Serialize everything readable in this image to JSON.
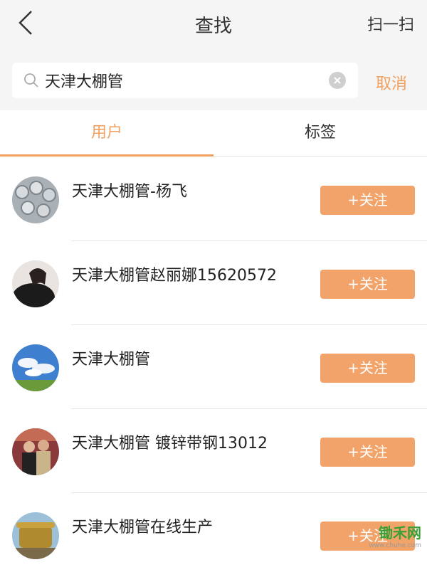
{
  "header": {
    "title": "查找",
    "scan_label": "扫一扫"
  },
  "search": {
    "value": "天津大棚管",
    "cancel_label": "取消"
  },
  "tabs": [
    {
      "label": "用户",
      "active": true
    },
    {
      "label": "标签",
      "active": false
    }
  ],
  "results": [
    {
      "name": "天津大棚管-杨飞",
      "follow_label": "+关注",
      "avatar": "pipes-photo"
    },
    {
      "name": "天津大棚管赵丽娜15620572",
      "follow_label": "+关注",
      "avatar": "woman-portrait"
    },
    {
      "name": "天津大棚管",
      "follow_label": "+关注",
      "avatar": "sky-clouds"
    },
    {
      "name": "天津大棚管 镀锌带钢13012",
      "follow_label": "+关注",
      "avatar": "couple-photo"
    },
    {
      "name": "天津大棚管在线生产",
      "follow_label": "+关注",
      "avatar": "brass-vessel"
    }
  ],
  "watermark": {
    "text": "锄禾网",
    "sub": "www.chuhe.com"
  },
  "colors": {
    "accent": "#f0a060",
    "button": "#f2a36a",
    "header_bg": "#f5f5f5"
  }
}
